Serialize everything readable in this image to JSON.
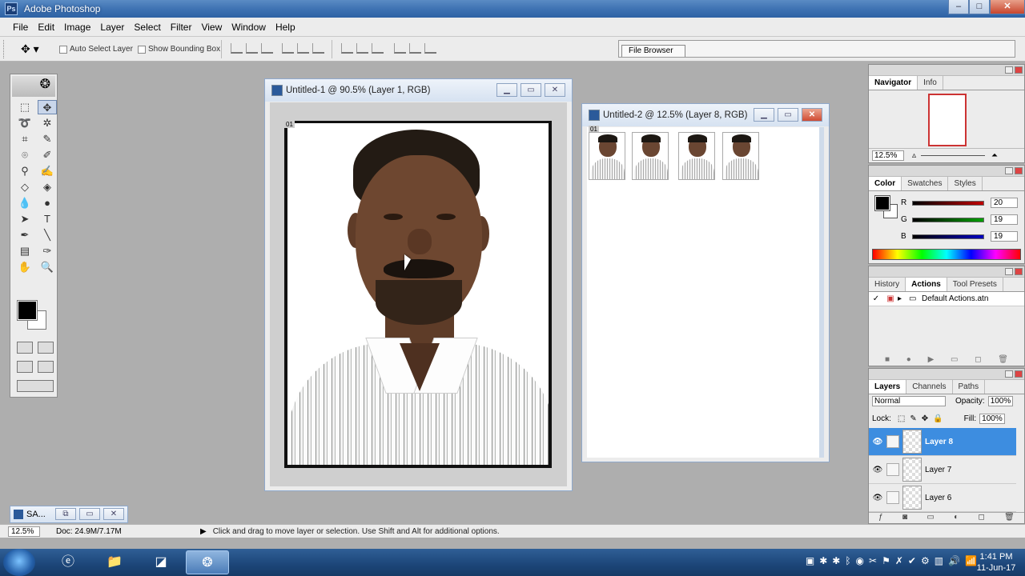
{
  "app": {
    "title": "Adobe Photoshop",
    "icon": "photoshop-icon"
  },
  "window_buttons": [
    "–",
    "□",
    "✕"
  ],
  "menu": [
    "File",
    "Edit",
    "Image",
    "Layer",
    "Select",
    "Filter",
    "View",
    "Window",
    "Help"
  ],
  "options": {
    "auto_select": "Auto Select Layer",
    "show_bbox": "Show Bounding Box",
    "file_browser": "File Browser"
  },
  "doc1": {
    "title": "Untitled-1 @ 90.5% (Layer 1, RGB)",
    "layer_badge": "01"
  },
  "doc2": {
    "title": "Untitled-2 @ 12.5% (Layer 8, RGB)",
    "layer_badge": "01",
    "thumb_count": 4
  },
  "minidoc": {
    "title": "SA..."
  },
  "navigator": {
    "tabs": [
      "Navigator",
      "Info"
    ],
    "zoom": "12.5%"
  },
  "color": {
    "tabs": [
      "Color",
      "Swatches",
      "Styles"
    ],
    "channels": [
      {
        "label": "R",
        "value": "20",
        "color": "#c00000"
      },
      {
        "label": "G",
        "value": "19",
        "color": "#00a000"
      },
      {
        "label": "B",
        "value": "19",
        "color": "#0000c0"
      }
    ]
  },
  "history": {
    "tabs": [
      "History",
      "Actions",
      "Tool Presets"
    ],
    "action_set": "Default Actions.atn"
  },
  "layers": {
    "tabs": [
      "Layers",
      "Channels",
      "Paths"
    ],
    "blend_mode": "Normal",
    "opacity_label": "Opacity:",
    "opacity": "100%",
    "lock_label": "Lock:",
    "fill_label": "Fill:",
    "fill": "100%",
    "items": [
      "Layer 8",
      "Layer 7",
      "Layer 6"
    ],
    "selected": "Layer 8"
  },
  "status": {
    "zoom": "12.5%",
    "doc_info": "Doc: 24.9M/7.17M",
    "hint": "Click and drag to move layer or selection. Use Shift and Alt for additional options."
  },
  "taskbar": {
    "time": "1:41 PM",
    "date": "11-Jun-17"
  },
  "colors": {
    "accent": "#3d8de0",
    "titlebar": "#3f73b3"
  }
}
